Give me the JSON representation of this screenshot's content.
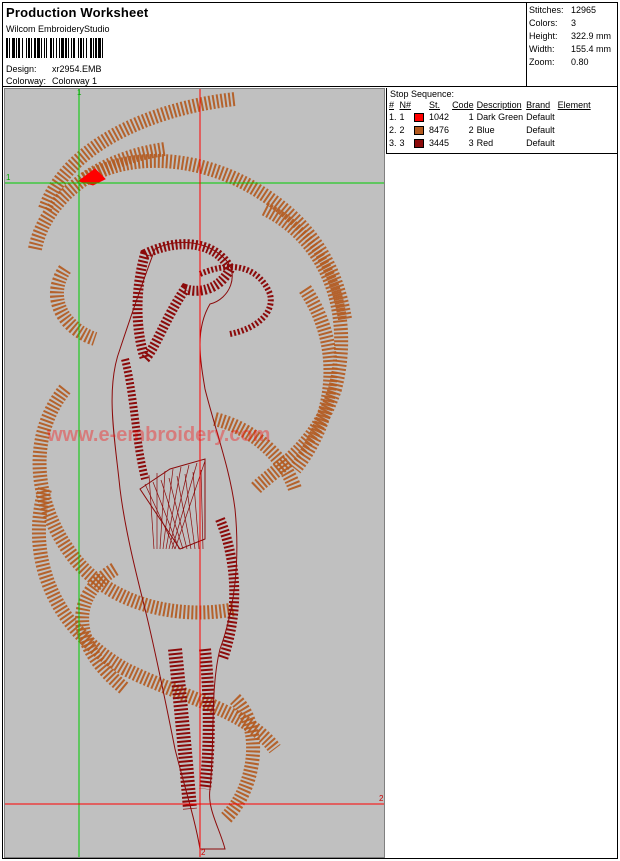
{
  "header": {
    "title": "Production Worksheet",
    "subtitle": "Wilcom EmbroideryStudio",
    "design_label": "Design:",
    "design_value": "xr2954.EMB",
    "colorway_label": "Colorway:",
    "colorway_value": "Colorway 1"
  },
  "stats": {
    "stitches_label": "Stitches:",
    "stitches_value": "12965",
    "colors_label": "Colors:",
    "colors_value": "3",
    "height_label": "Height:",
    "height_value": "322.9 mm",
    "width_label": "Width:",
    "width_value": "155.4 mm",
    "zoom_label": "Zoom:",
    "zoom_value": "0.80"
  },
  "stops": {
    "heading": "Stop Sequence:",
    "columns": [
      "#",
      "N#",
      "St.",
      "Code",
      "Description",
      "Brand",
      "Element"
    ],
    "rows": [
      {
        "num": "1.",
        "n": "1",
        "color": "#ff0000",
        "st": "1042",
        "code": "1",
        "desc": "Dark Green",
        "brand": "Default"
      },
      {
        "num": "2.",
        "n": "2",
        "color": "#b35a1f",
        "st": "8476",
        "code": "2",
        "desc": "Blue",
        "brand": "Default"
      },
      {
        "num": "3.",
        "n": "3",
        "color": "#8b0a0a",
        "st": "3445",
        "code": "3",
        "desc": "Red",
        "brand": "Default"
      }
    ]
  },
  "canvas": {
    "guide_label_1": "1",
    "guide_label_2": "2",
    "watermark": "www.e-embroidery.com",
    "colors": {
      "background": "#c0c0c0",
      "dragon": "#b35a1f",
      "figure": "#8b0a0a",
      "accent": "#ff0000",
      "green_guide": "#00cc00",
      "red_guide": "#ff0000"
    }
  }
}
